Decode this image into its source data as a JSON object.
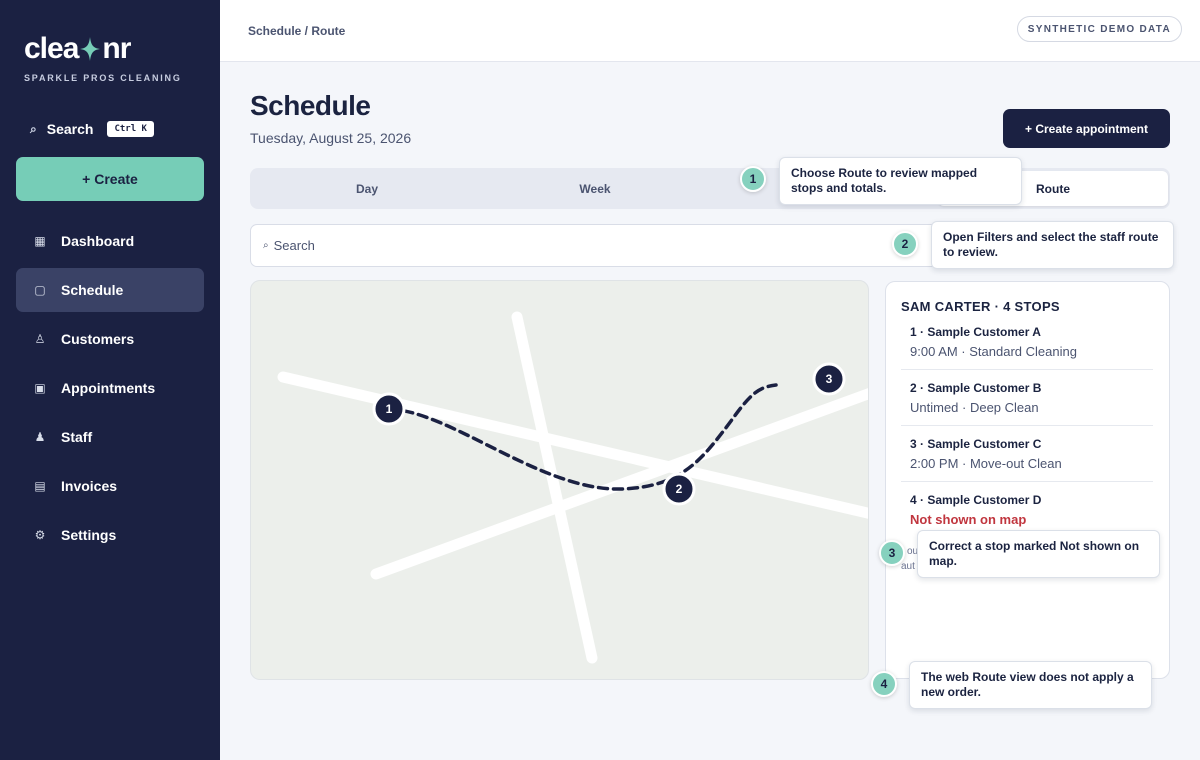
{
  "brand": {
    "logo_left": "clea",
    "logo_right": "nr",
    "tagline": "SPARKLE PROS CLEANING"
  },
  "sidebar": {
    "search_label": "Search",
    "search_shortcut": "Ctrl K",
    "create_label": "+ Create",
    "items": [
      {
        "label": "Dashboard",
        "icon": "grid-icon"
      },
      {
        "label": "Schedule",
        "icon": "calendar-icon",
        "active": true
      },
      {
        "label": "Customers",
        "icon": "person-icon"
      },
      {
        "label": "Appointments",
        "icon": "square-icon"
      },
      {
        "label": "Staff",
        "icon": "staff-icon"
      },
      {
        "label": "Invoices",
        "icon": "document-icon"
      },
      {
        "label": "Settings",
        "icon": "gear-icon"
      }
    ]
  },
  "topbar": {
    "breadcrumb": "Schedule / Route",
    "badge": "SYNTHETIC DEMO DATA"
  },
  "main": {
    "title": "Schedule",
    "date": "Tuesday, August 25, 2026",
    "create_appointment": "+ Create appointment",
    "tabs": [
      {
        "label": "Day"
      },
      {
        "label": "Week"
      },
      {
        "label": ""
      },
      {
        "label": "Route",
        "active": true
      }
    ],
    "search_placeholder": "Search"
  },
  "map": {
    "markers": [
      {
        "label": "1"
      },
      {
        "label": "2"
      },
      {
        "label": "3"
      }
    ],
    "route_color": "#1b2142"
  },
  "stops_panel": {
    "header": "SAM CARTER · 4 STOPS",
    "stops": [
      {
        "name": "1 · Sample Customer A",
        "detail": "9:00 AM · Standard Cleaning",
        "warning": false
      },
      {
        "name": "2 · Sample Customer B",
        "detail": "Untimed · Deep Clean",
        "warning": false
      },
      {
        "name": "3 · Sample Customer C",
        "detail": "2:00 PM · Move-out Clean",
        "warning": false
      },
      {
        "name": "4 · Sample Customer D",
        "detail": "Not shown on map",
        "warning": true
      }
    ],
    "note_fragment_1": "ou",
    "note_fragment_2": "aut"
  },
  "callouts": [
    {
      "number": "1",
      "text": "Choose Route to review mapped stops and totals."
    },
    {
      "number": "2",
      "text": "Open Filters and select the staff route to review."
    },
    {
      "number": "3",
      "text": "Correct a stop marked Not shown on map."
    },
    {
      "number": "4",
      "text": "The web Route view does not apply a new order."
    }
  ],
  "colors": {
    "sidebar": "#1b2142",
    "accent": "#76cdb7",
    "warning": "#c0353e"
  }
}
